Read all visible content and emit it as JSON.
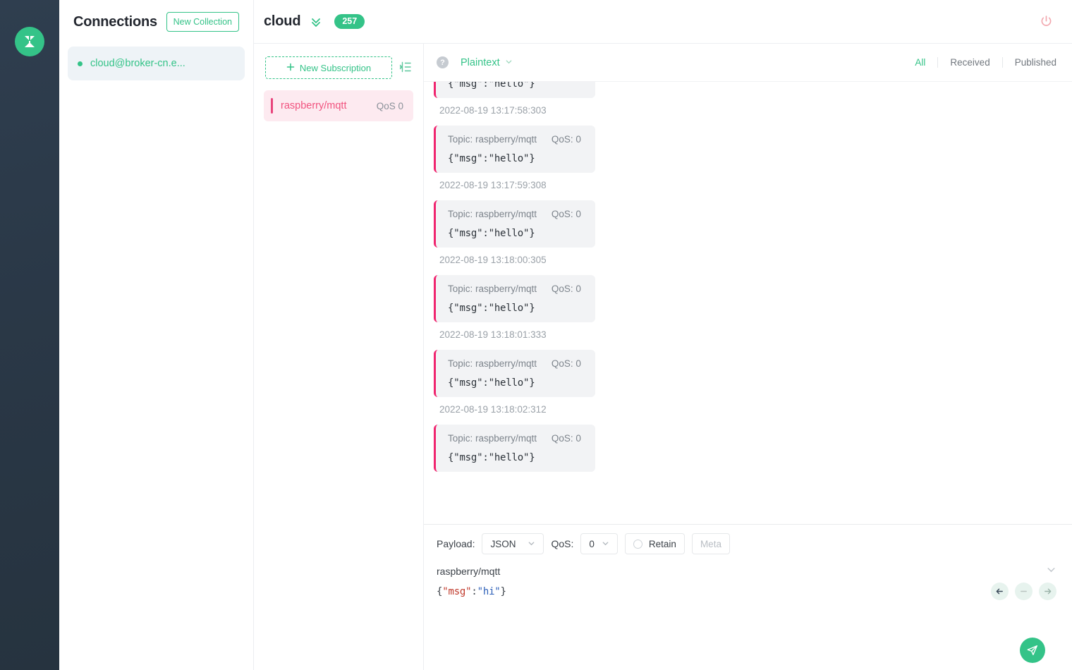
{
  "rail": {
    "logo_icon": "mqttx-logo-icon",
    "logo_color": "#34c388"
  },
  "connections": {
    "title": "Connections",
    "new_collection_label": "New Collection",
    "items": [
      {
        "name": "cloud@broker-cn.e...",
        "status": "connected",
        "status_color": "#34c388"
      }
    ]
  },
  "topbar": {
    "title": "cloud",
    "expand_icon": "chevron-double-down-icon",
    "message_count": "257",
    "badge_color": "#34c388",
    "power_icon": "power-icon",
    "power_color": "#f0a5ad"
  },
  "subscriptions": {
    "new_subscription_label": "New Subscription",
    "plus_icon": "plus-icon",
    "collapse_icon": "collapse-panel-icon",
    "items": [
      {
        "topic": "raspberry/mqtt",
        "qos": "QoS 0",
        "accent": "#e8457c"
      }
    ]
  },
  "messages_toolbar": {
    "help_icon": "question-circle-icon",
    "format": "Plaintext",
    "format_chevron": "chevron-down-icon",
    "filters": [
      {
        "label": "All",
        "active": true
      },
      {
        "label": "Received",
        "active": false
      },
      {
        "label": "Published",
        "active": false
      }
    ]
  },
  "messages": [
    {
      "topic_label": "",
      "qos_label": "",
      "payload": "{\"msg\":\"hello\"}",
      "time": "2022-08-19 13:17:58:303",
      "clipped": true
    },
    {
      "topic_label": "Topic: raspberry/mqtt",
      "qos_label": "QoS: 0",
      "payload": "{\"msg\":\"hello\"}",
      "time": "2022-08-19 13:17:59:308",
      "clipped": false
    },
    {
      "topic_label": "Topic: raspberry/mqtt",
      "qos_label": "QoS: 0",
      "payload": "{\"msg\":\"hello\"}",
      "time": "2022-08-19 13:18:00:305",
      "clipped": false
    },
    {
      "topic_label": "Topic: raspberry/mqtt",
      "qos_label": "QoS: 0",
      "payload": "{\"msg\":\"hello\"}",
      "time": "2022-08-19 13:18:01:333",
      "clipped": false
    },
    {
      "topic_label": "Topic: raspberry/mqtt",
      "qos_label": "QoS: 0",
      "payload": "{\"msg\":\"hello\"}",
      "time": "2022-08-19 13:18:02:312",
      "clipped": false
    },
    {
      "topic_label": "Topic: raspberry/mqtt",
      "qos_label": "QoS: 0",
      "payload": "{\"msg\":\"hello\"}",
      "time": "",
      "clipped": false
    }
  ],
  "publish": {
    "payload_label": "Payload:",
    "payload_format": "JSON",
    "qos_label": "QoS:",
    "qos_value": "0",
    "retain_label": "Retain",
    "retain_checked": false,
    "meta_label": "Meta",
    "topic": "raspberry/mqtt",
    "topic_chevron": "chevron-down-icon",
    "editor": {
      "open_brace": "{",
      "key": "\"msg\"",
      "colon": ":",
      "value": "\"hi\"",
      "close_brace": "}"
    },
    "nav": {
      "back_icon": "arrow-left-icon",
      "minus_icon": "minus-icon",
      "forward_icon": "arrow-right-icon"
    },
    "send_icon": "send-plane-icon",
    "send_color": "#34c388"
  }
}
